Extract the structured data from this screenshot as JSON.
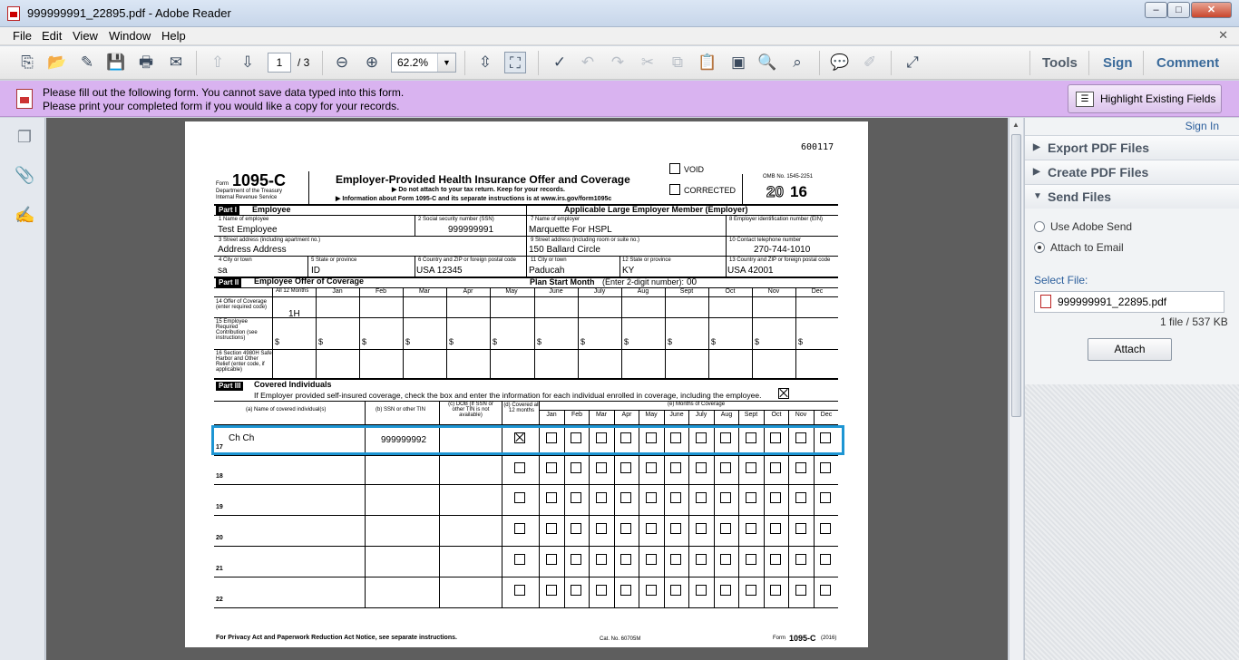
{
  "window": {
    "title": "999999991_22895.pdf - Adobe Reader",
    "min": "–",
    "max": "□",
    "close": "✕"
  },
  "menu": {
    "file": "File",
    "edit": "Edit",
    "view": "View",
    "window": "Window",
    "help": "Help",
    "close": "✕"
  },
  "toolbar": {
    "page_current": "1",
    "page_total": "/ 3",
    "zoom": "62.2%",
    "tools": "Tools",
    "sign": "Sign",
    "comment": "Comment"
  },
  "notice": {
    "line1": "Please fill out the following form. You cannot save data typed into this form.",
    "line2": "Please print your completed form if you would like a copy for your records.",
    "highlight_btn": "Highlight Existing Fields"
  },
  "form": {
    "code": "600117",
    "form_label": "Form",
    "form_number": "1095-C",
    "dept1": "Department of the Treasury",
    "dept2": "Internal Revenue Service",
    "title": "Employer-Provided Health Insurance Offer and Coverage",
    "sub1": "▶ Do not attach to your tax return. Keep for your records.",
    "sub2": "▶ Information about Form 1095-C and its separate instructions is at www.irs.gov/form1095c",
    "void": "VOID",
    "corrected": "CORRECTED",
    "omb": "OMB No. 1545-2251",
    "year_pre": "20",
    "year_post": "16",
    "part1": "Part I",
    "part1_title": "Employee",
    "employer_title": "Applicable Large Employer Member (Employer)",
    "f1_label": "1 Name of employee",
    "f1_value": "Test Employee",
    "f2_label": "2 Social security number (SSN)",
    "f2_value": "999999991",
    "f7_label": "7 Name of employer",
    "f7_value": "Marquette For HSPL",
    "f8_label": "8 Employer identification number (EIN)",
    "f3_label": "3 Street address (including apartment no.)",
    "f3_value": "Address Address",
    "f9_label": "9 Street address (including room or suite no.)",
    "f9_value": "150 Ballard Circle",
    "f10_label": "10 Contact telephone number",
    "f10_value": "270-744-1010",
    "f4_label": "4 City or town",
    "f4_value": "sa",
    "f5_label": "5 State or province",
    "f5_value": "ID",
    "f6_label": "6 Country and ZIP or foreign postal code",
    "f6_value": "USA 12345",
    "f11_label": "11 City or town",
    "f11_value": "Paducah",
    "f12_label": "12 State or province",
    "f12_value": "KY",
    "f13_label": "13 Country and ZIP or foreign postal code",
    "f13_value": "USA 42001",
    "part2": "Part II",
    "part2_title": "Employee Offer of Coverage",
    "plan_start": "Plan Start Month",
    "plan_start_note": "(Enter 2-digit number):",
    "plan_start_value": "00",
    "all12": "All 12 Months",
    "months": [
      "Jan",
      "Feb",
      "Mar",
      "Apr",
      "May",
      "June",
      "July",
      "Aug",
      "Sept",
      "Oct",
      "Nov",
      "Dec"
    ],
    "l14_label": "14 Offer of Coverage (enter required code)",
    "l14_all12": "1H",
    "l15_label": "15 Employee Required Contribution (see instructions)",
    "dollar": "$",
    "l16_label": "16 Section 4980H Safe Harbor and Other Relief (enter code, if applicable)",
    "part3": "Part III",
    "part3_title": "Covered Individuals",
    "part3_note": "If Employer provided self-insured coverage, check the box and enter the information for each individual enrolled in coverage, including the employee.",
    "col_a": "(a) Name of covered individual(s)",
    "col_b": "(b) SSN or other TIN",
    "col_c": "(c) DOB (If SSN or other TIN is not available)",
    "col_d": "(d) Covered all 12 months",
    "col_e": "(e) Months of Coverage",
    "months_short": [
      "Jan",
      "Feb",
      "Mar",
      "Apr",
      "May",
      "June",
      "July",
      "Aug",
      "Sept",
      "Oct",
      "Nov",
      "Dec"
    ],
    "rows": [
      {
        "num": "17",
        "name": "Ch Ch",
        "ssn": "999999992",
        "all12": true
      },
      {
        "num": "18",
        "name": "",
        "ssn": "",
        "all12": false
      },
      {
        "num": "19",
        "name": "",
        "ssn": "",
        "all12": false
      },
      {
        "num": "20",
        "name": "",
        "ssn": "",
        "all12": false
      },
      {
        "num": "21",
        "name": "",
        "ssn": "",
        "all12": false
      },
      {
        "num": "22",
        "name": "",
        "ssn": "",
        "all12": false
      }
    ],
    "footer_left": "For Privacy Act and Paperwork Reduction Act Notice, see separate instructions.",
    "footer_cat": "Cat. No. 60705M",
    "footer_right_pre": "Form",
    "footer_right_num": "1095-C",
    "footer_right_year": "(2016)"
  },
  "rpane": {
    "signin": "Sign In",
    "export": "Export PDF Files",
    "create": "Create PDF Files",
    "send": "Send Files",
    "opt1": "Use Adobe Send",
    "opt2": "Attach to Email",
    "select_file": "Select File:",
    "file": "999999991_22895.pdf",
    "file_info": "1 file / 537 KB",
    "attach": "Attach"
  }
}
